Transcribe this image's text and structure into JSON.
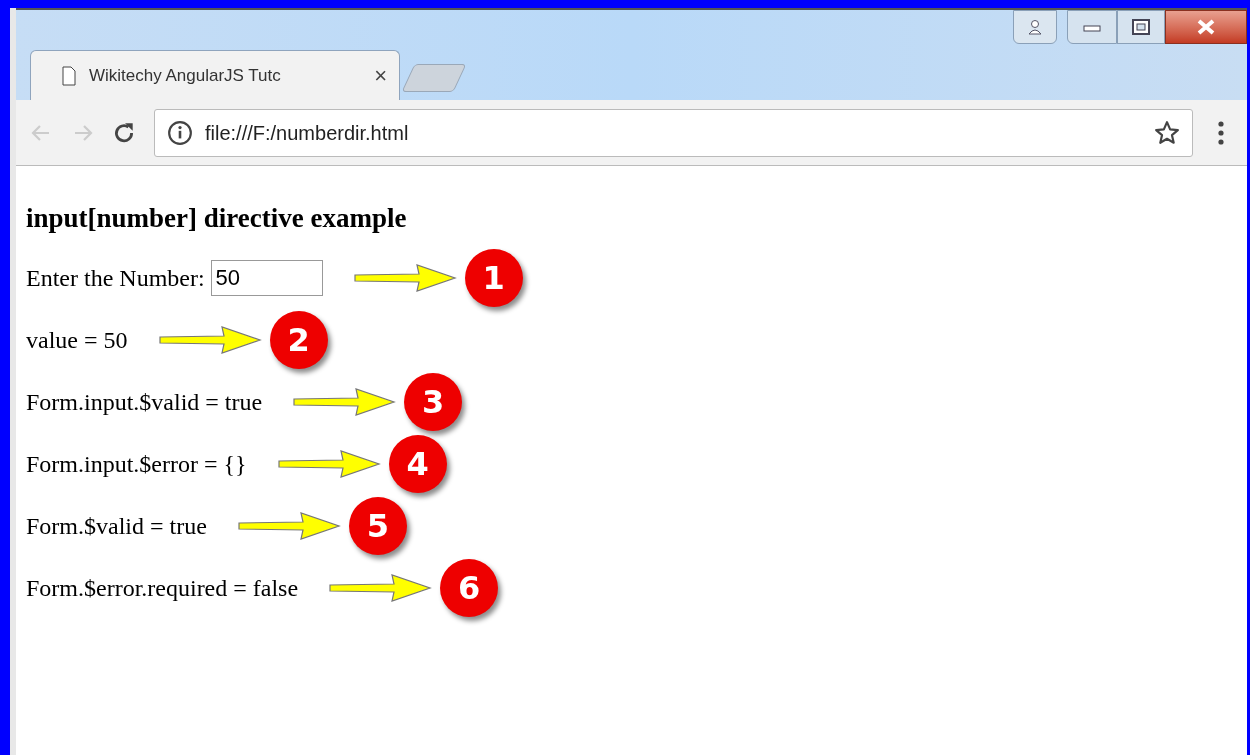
{
  "tab": {
    "title": "Wikitechy AngularJS Tutc",
    "close": "×"
  },
  "address_bar": {
    "url": "file:///F:/numberdir.html"
  },
  "page": {
    "heading": "input[number] directive example",
    "rows": [
      {
        "kind": "input",
        "label": "Enter the Number:",
        "value": "50",
        "badge": "1"
      },
      {
        "kind": "text",
        "text": "value = 50",
        "badge": "2"
      },
      {
        "kind": "text",
        "text": "Form.input.$valid = true",
        "badge": "3"
      },
      {
        "kind": "text",
        "text": "Form.input.$error = {}",
        "badge": "4"
      },
      {
        "kind": "text",
        "text": "Form.$valid = true",
        "badge": "5"
      },
      {
        "kind": "text",
        "text": "Form.$error.required = false",
        "badge": "6"
      }
    ]
  }
}
